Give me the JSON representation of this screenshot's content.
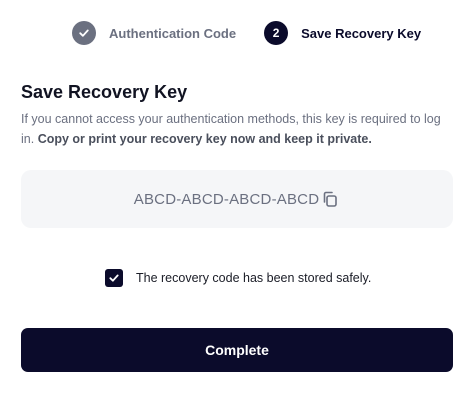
{
  "stepper": {
    "steps": [
      {
        "label": "Authentication Code",
        "state": "completed",
        "icon": "check-icon"
      },
      {
        "label": "Save Recovery Key",
        "state": "active",
        "number": "2"
      }
    ]
  },
  "main": {
    "title": "Save Recovery Key",
    "description_plain": "If you cannot access your authentication methods, this key is required to log in.",
    "description_bold": "Copy or print your recovery key now and keep it private.",
    "recovery_key": "ABCD-ABCD-ABCD-ABCD",
    "copy_icon": "copy-icon"
  },
  "confirm": {
    "checked": true,
    "label": "The recovery code has been stored safely."
  },
  "actions": {
    "complete_label": "Complete"
  },
  "colors": {
    "primary": "#0b0b2b",
    "muted": "#6b7080",
    "key_background": "#f5f6f8"
  }
}
